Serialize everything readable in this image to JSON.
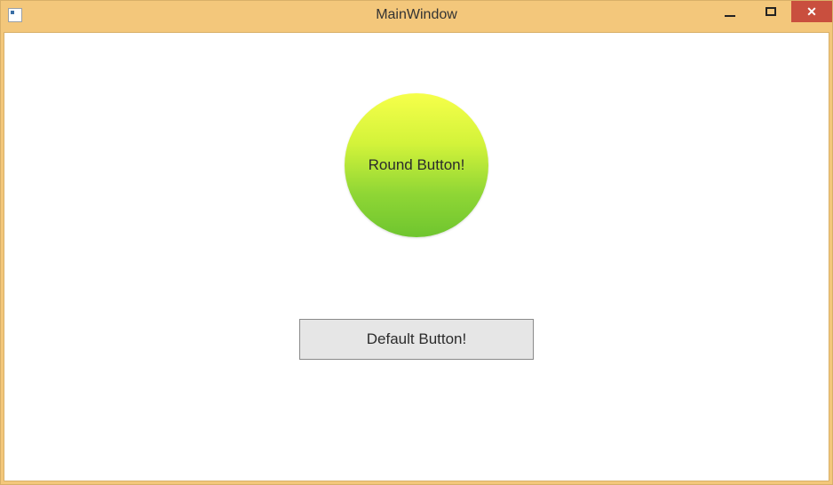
{
  "window": {
    "title": "MainWindow"
  },
  "buttons": {
    "round_label": "Round Button!",
    "default_label": "Default Button!"
  }
}
